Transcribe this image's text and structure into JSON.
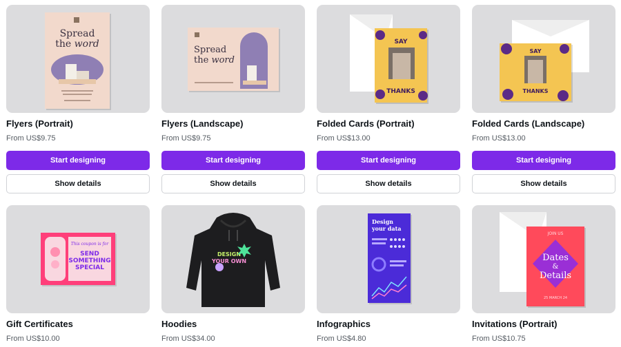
{
  "products": [
    {
      "title": "Flyers (Portrait)",
      "price": "From US$9.75",
      "cta": "Start designing",
      "details": "Show details",
      "art": "Spread the word"
    },
    {
      "title": "Flyers (Landscape)",
      "price": "From US$9.75",
      "cta": "Start designing",
      "details": "Show details",
      "art": "Spread the word"
    },
    {
      "title": "Folded Cards (Portrait)",
      "price": "From US$13.00",
      "cta": "Start designing",
      "details": "Show details",
      "art_top": "SAY",
      "art_bottom": "THANKS"
    },
    {
      "title": "Folded Cards (Landscape)",
      "price": "From US$13.00",
      "cta": "Start designing",
      "details": "Show details",
      "art_top": "SAY",
      "art_bottom": "THANKS"
    },
    {
      "title": "Gift Certificates",
      "price": "From US$10.00",
      "art_line1": "This coupon is for",
      "art_line2": "SEND SOMETHING SPECIAL"
    },
    {
      "title": "Hoodies",
      "price": "From US$34.00",
      "art": "DESIGN YOUR OWN"
    },
    {
      "title": "Infographics",
      "price": "From US$4.80",
      "art": "Design your data"
    },
    {
      "title": "Invitations (Portrait)",
      "price": "From US$10.75",
      "art_top": "JOIN US",
      "art_line1": "Dates",
      "art_line2": "&",
      "art_line3": "Details",
      "art_date": "25 MARCH 24"
    }
  ],
  "colors": {
    "primary": "#7d2ae8",
    "thumb_bg": "#dcdcde"
  }
}
